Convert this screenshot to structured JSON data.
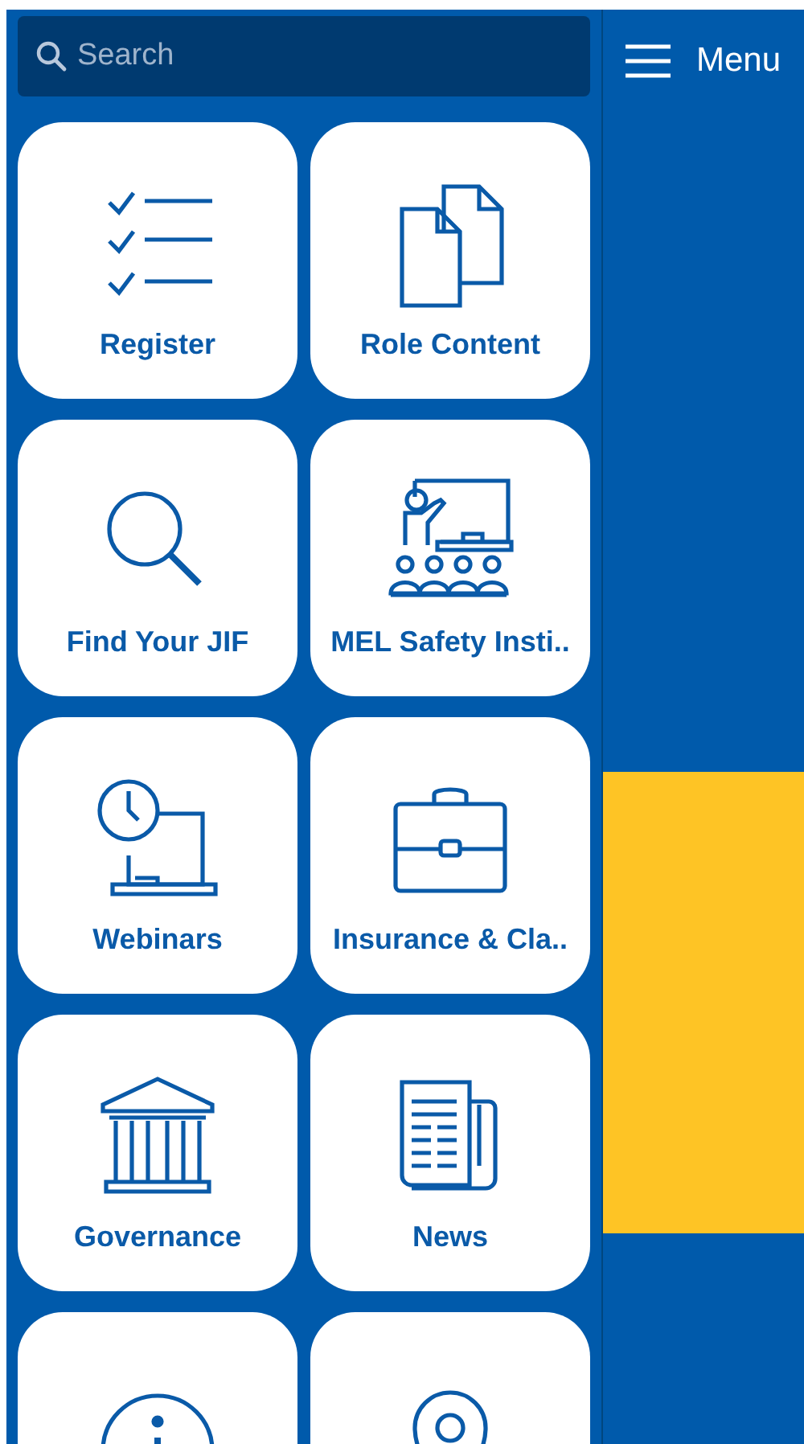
{
  "search": {
    "placeholder": "Search"
  },
  "menu": {
    "label": "Menu"
  },
  "tiles": [
    {
      "label": "Register",
      "kind": "checklist"
    },
    {
      "label": "Role Content",
      "kind": "documents"
    },
    {
      "label": "Find Your JIF",
      "kind": "magnifier"
    },
    {
      "label": "MEL Safety Insti..",
      "kind": "classroom"
    },
    {
      "label": "Webinars",
      "kind": "webinar"
    },
    {
      "label": "Insurance & Cla..",
      "kind": "briefcase"
    },
    {
      "label": "Governance",
      "kind": "building"
    },
    {
      "label": "News",
      "kind": "newspaper"
    },
    {
      "kind": "info"
    },
    {
      "kind": "pin"
    }
  ]
}
